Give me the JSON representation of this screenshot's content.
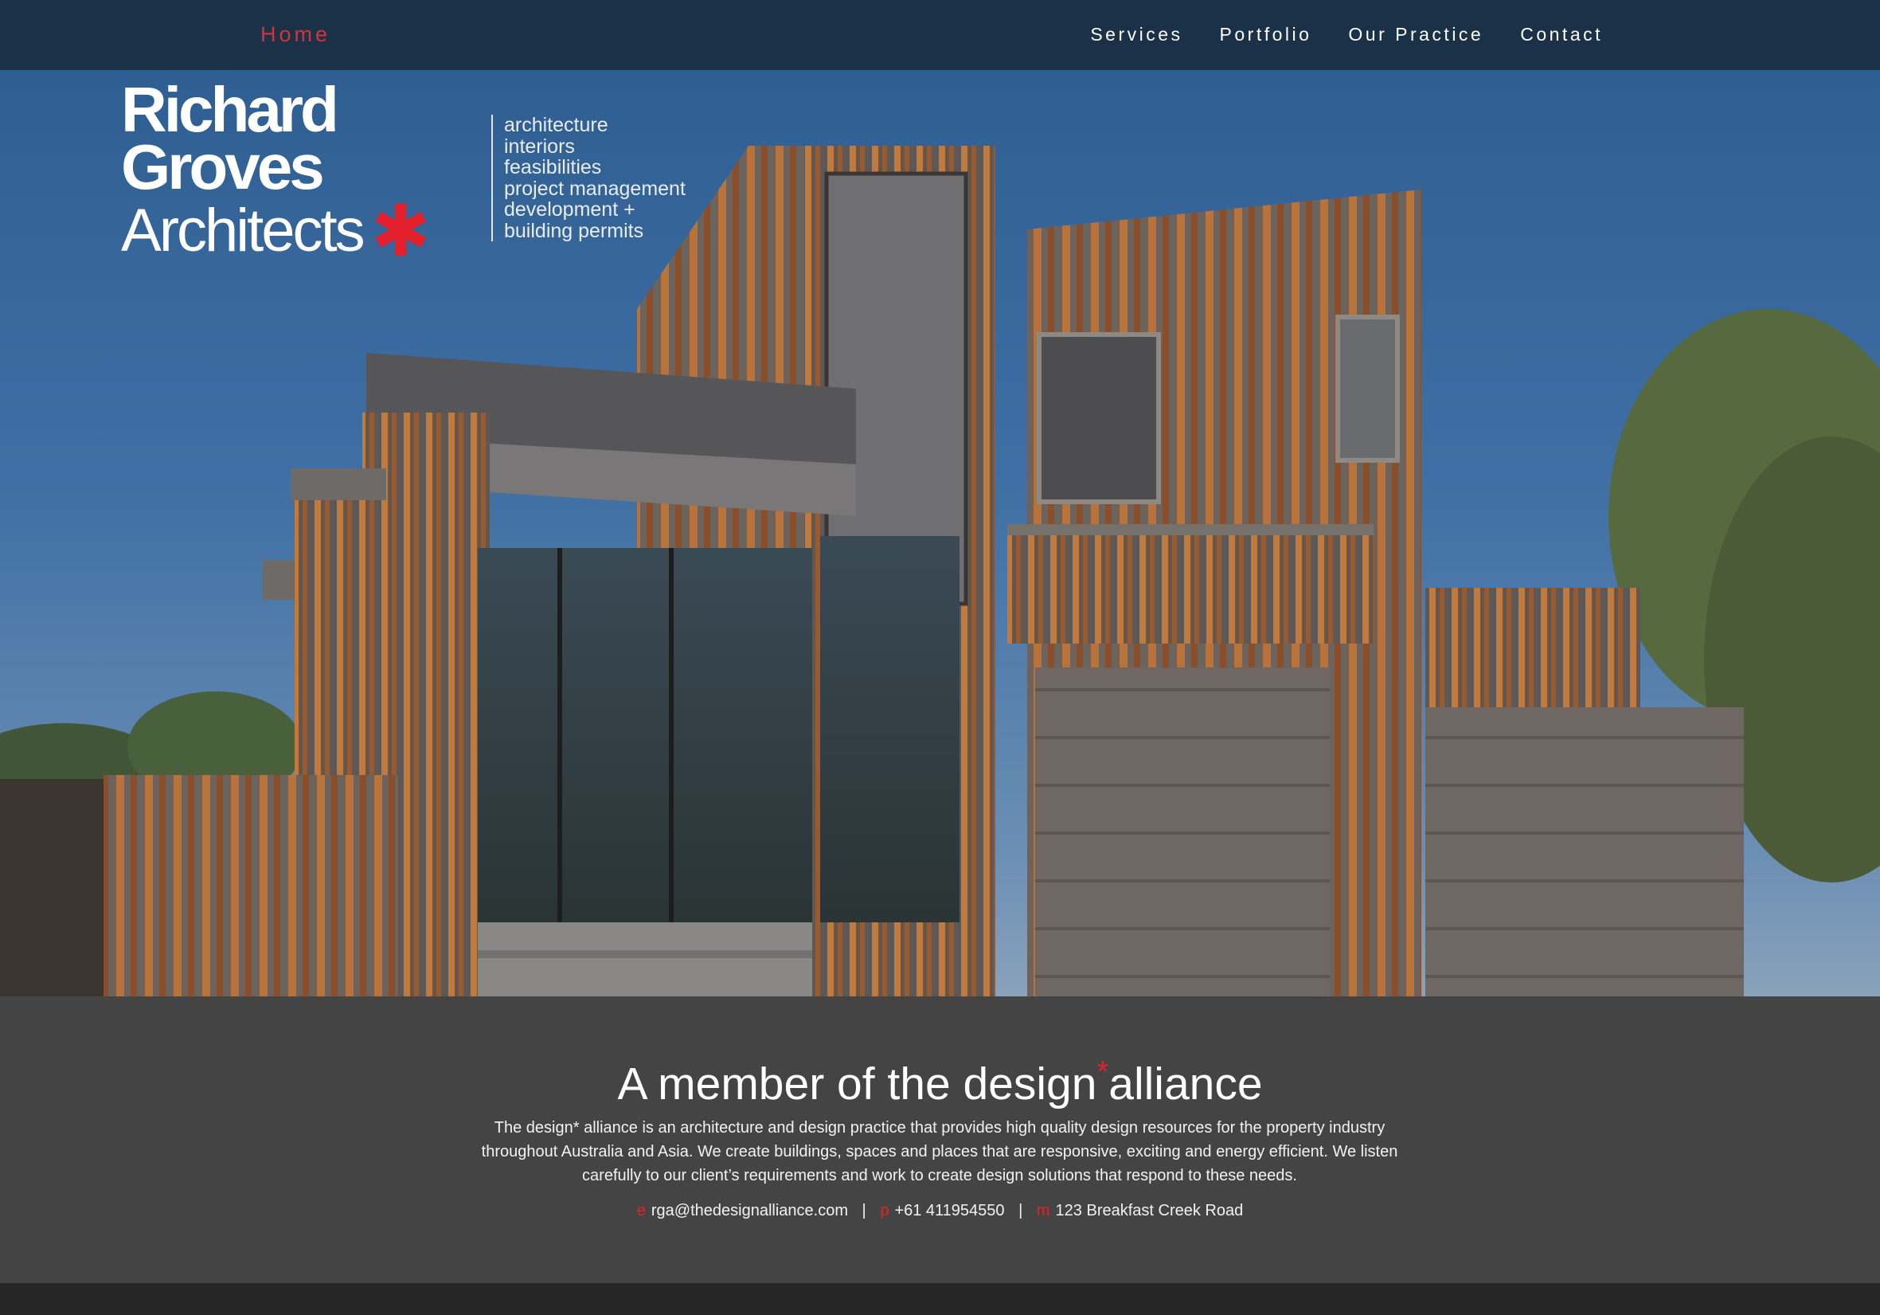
{
  "nav": {
    "home": "Home",
    "items": [
      "Services",
      "Portfolio",
      "Our Practice",
      "Contact"
    ]
  },
  "logo": {
    "line1": "Richard",
    "line2": "Groves",
    "line3": "Architects",
    "mark": "✱"
  },
  "services": [
    "architecture",
    "interiors",
    "feasibilities",
    "project management",
    "development +",
    "building permits"
  ],
  "alliance": {
    "heading_pre": "A member of the design",
    "heading_ast": "*",
    "heading_post": "alliance",
    "description": "The design* alliance is an architecture and design practice that provides high quality design resources for the property industry throughout Australia and Asia. We create buildings, spaces and places that are responsive, exciting and energy efficient. We listen carefully to our client’s requirements and work to create design solutions that respond to these needs.",
    "contact": {
      "email_label": "e",
      "email": "rga@thedesignalliance.com",
      "phone_label": "p",
      "phone": "+61 411954550",
      "address_label": "m",
      "address": "123 Breakfast Creek Road",
      "separator": "|"
    }
  },
  "colors": {
    "nav_bg": "#1b3148",
    "accent": "#e3202b",
    "section_bg": "#444444",
    "footer_bg": "#262626"
  }
}
